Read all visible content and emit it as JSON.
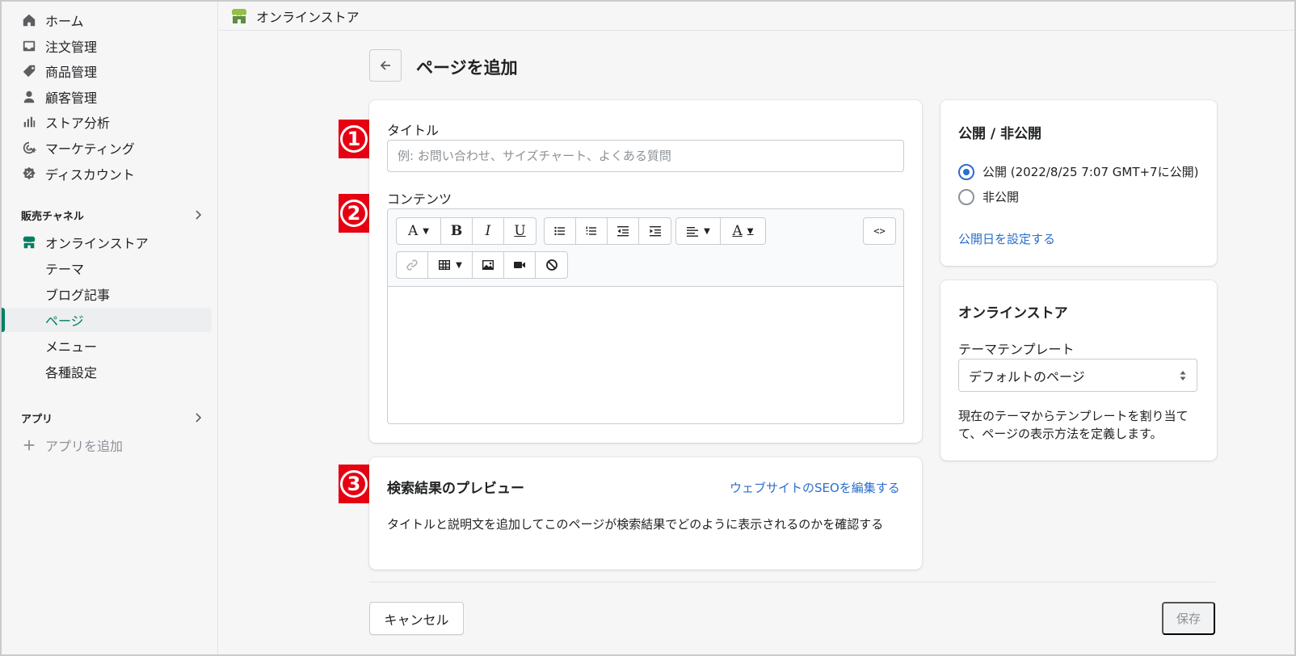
{
  "sidebar": {
    "items": [
      {
        "label": "ホーム",
        "icon": "home-icon"
      },
      {
        "label": "注文管理",
        "icon": "inbox-icon"
      },
      {
        "label": "商品管理",
        "icon": "tag-icon"
      },
      {
        "label": "顧客管理",
        "icon": "person-icon"
      },
      {
        "label": "ストア分析",
        "icon": "bar-chart-icon"
      },
      {
        "label": "マーケティング",
        "icon": "target-icon"
      },
      {
        "label": "ディスカウント",
        "icon": "discount-icon"
      }
    ],
    "sales_channel_heading": "販売チャネル",
    "online_store": "オンラインストア",
    "sub_items": [
      "テーマ",
      "ブログ記事",
      "ページ",
      "メニュー",
      "各種設定"
    ],
    "active_sub_item": "ページ",
    "apps_heading": "アプリ",
    "add_app": "アプリを追加"
  },
  "topbar": {
    "title": "オンラインストア"
  },
  "page": {
    "title": "ページを追加"
  },
  "form": {
    "title_label": "タイトル",
    "title_placeholder": "例: お問い合わせ、サイズチャート、よくある質問",
    "content_label": "コンテンツ",
    "toolbar_glyphs": {
      "font": "A",
      "bold": "B",
      "italic": "I",
      "underline": "U",
      "color": "A",
      "code": "<>"
    }
  },
  "markers": [
    "1",
    "2",
    "3"
  ],
  "seo": {
    "title": "検索結果のプレビュー",
    "edit_link": "ウェブサイトのSEOを編集する",
    "description": "タイトルと説明文を追加してこのページが検索結果でどのように表示されるのかを確認する"
  },
  "visibility": {
    "title": "公開 / 非公開",
    "options": [
      {
        "label": "公開 (2022/8/25 7:07 GMT+7に公開)",
        "checked": true
      },
      {
        "label": "非公開",
        "checked": false
      }
    ],
    "set_date_link": "公開日を設定する"
  },
  "online_store_card": {
    "title": "オンラインストア",
    "template_label": "テーマテンプレート",
    "template_value": "デフォルトのページ",
    "help": "現在のテーマからテンプレートを割り当てて、ページの表示方法を定義します。"
  },
  "footer": {
    "cancel": "キャンセル",
    "save": "保存"
  },
  "colors": {
    "accent": "#008060",
    "link": "#2c6ecb",
    "marker": "#e60012"
  }
}
